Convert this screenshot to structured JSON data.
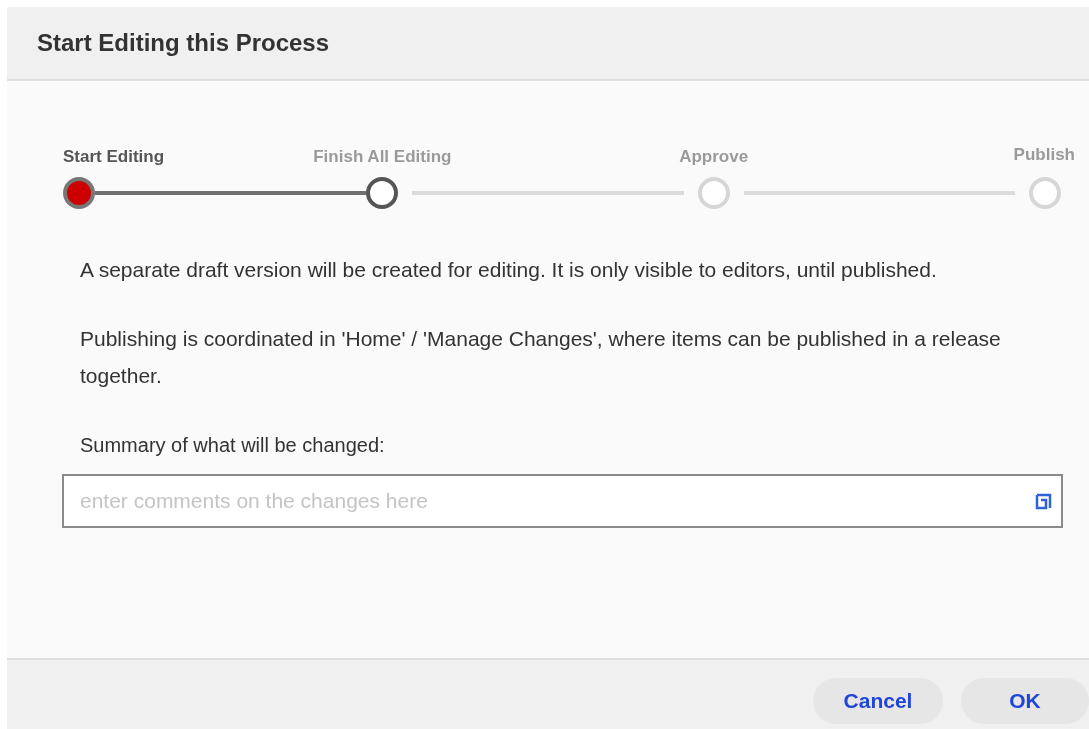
{
  "dialog": {
    "title": "Start Editing this Process",
    "steps": [
      {
        "label": "Start Editing",
        "selected": true,
        "reached": true
      },
      {
        "label": "Finish All Editing",
        "selected": false,
        "reached": true
      },
      {
        "label": "Approve",
        "selected": false,
        "reached": false
      },
      {
        "label": "Publish",
        "selected": false,
        "reached": false
      }
    ],
    "paragraphs": [
      "A separate draft version will be created for editing. It is only visible to editors, until published.",
      "Publishing is coordinated in 'Home' / 'Manage Changes', where items can be published in a release together."
    ],
    "summary": {
      "label": "Summary of what will be changed:",
      "placeholder": "enter comments on the changes here"
    },
    "buttons": [
      "Cancel",
      "OK"
    ]
  }
}
